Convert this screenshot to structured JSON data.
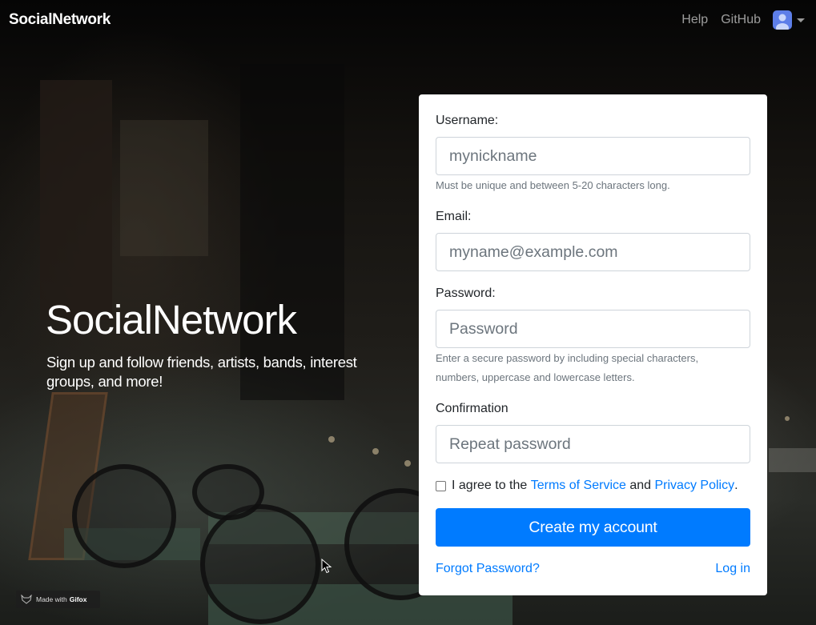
{
  "navbar": {
    "brand": "SocialNetwork",
    "links": [
      "Help",
      "GitHub"
    ],
    "avatar_icon": "user-avatar-icon",
    "accent": "#5d7ee8"
  },
  "hero": {
    "title": "SocialNetwork",
    "subtitle": "Sign up and follow friends, artists, bands, interest groups, and more!"
  },
  "form": {
    "username": {
      "label": "Username:",
      "placeholder": "mynickname",
      "value": "",
      "help": "Must be unique and between 5-20 characters long."
    },
    "email": {
      "label": "Email:",
      "placeholder": "myname@example.com",
      "value": ""
    },
    "password": {
      "label": "Password:",
      "placeholder": "Password",
      "value": "",
      "help_line1": "Enter a secure password by including special characters,",
      "help_line2": "numbers, uppercase and lowercase letters."
    },
    "confirmation": {
      "label": "Confirmation",
      "placeholder": "Repeat password",
      "value": ""
    },
    "agree": {
      "prefix": "I agree to the",
      "terms": "Terms of Service",
      "and": "and",
      "privacy": "Privacy Policy",
      "suffix": ".",
      "checked": false
    },
    "submit_label": "Create my account",
    "forgot_label": "Forgot Password?",
    "login_label": "Log in",
    "primary_color": "#007bff"
  },
  "watermark": {
    "made_with": "Made with",
    "brand": "Gifox"
  }
}
